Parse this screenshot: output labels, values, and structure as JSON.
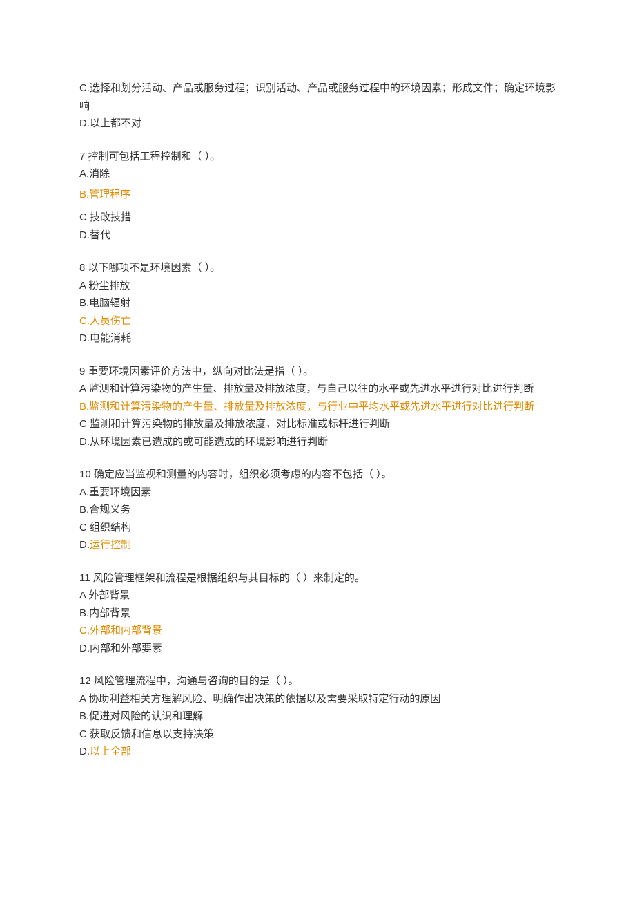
{
  "q6": {
    "c": "C.选择和划分活动、产品或服务过程；识别活动、产品或服务过程中的环境因素；形成文件；确定环境影响",
    "d": "D.以上都不对"
  },
  "q7": {
    "stem": "7 控制可包括工程控制和（ ）。",
    "a": "A.消除",
    "b": "B.管理程序",
    "c": "C 技改技措",
    "d": "D.替代"
  },
  "q8": {
    "stem": "8 以下哪项不是环境因素（ ）。",
    "a": "A 粉尘排放",
    "b": "B.电脑辐射",
    "c": "C.人员伤亡",
    "d": "D.电能消耗"
  },
  "q9": {
    "stem": "9 重要环境因素评价方法中，纵向对比法是指（ ）。",
    "a": "A 监测和计算污染物的产生量、排放量及排放浓度，与自己以往的水平或先进水平进行对比进行判断",
    "b": "B.监测和计算污染物的产生量、排放量及排放浓度，与行业中平均水平或先进水平进行对比进行判断",
    "c": "C 监测和计算污染物的排放量及排放浓度，对比标准或标杆进行判断",
    "d": "D.从环境因素已造成的或可能造成的环境影响进行判断"
  },
  "q10": {
    "stem": "10 确定应当监视和测量的内容时，组织必须考虑的内容不包括（ ）。",
    "a": "A.重要环境因素",
    "b": "B.合规义务",
    "c": "C 组织结构",
    "d_prefix": "D.",
    "d_hl": "运行控制"
  },
  "q11": {
    "stem": "11 风险管理框架和流程是根据组织与其目标的（ ）来制定的。",
    "a": "A 外部背景",
    "b": "B.内部背景",
    "c_prefix": "C,",
    "c_hl": "外部和内部背景",
    "d": "D.内部和外部要素"
  },
  "q12": {
    "stem": "12 风险管理流程中，沟通与咨询的目的是（ ）。",
    "a": "A 协助利益相关方理解风险、明确作出决策的依据以及需要采取特定行动的原因",
    "b": "B.促进对风险的认识和理解",
    "c": "C 获取反馈和信息以支持决策",
    "d_prefix": "D.",
    "d_hl": "以上全部"
  }
}
